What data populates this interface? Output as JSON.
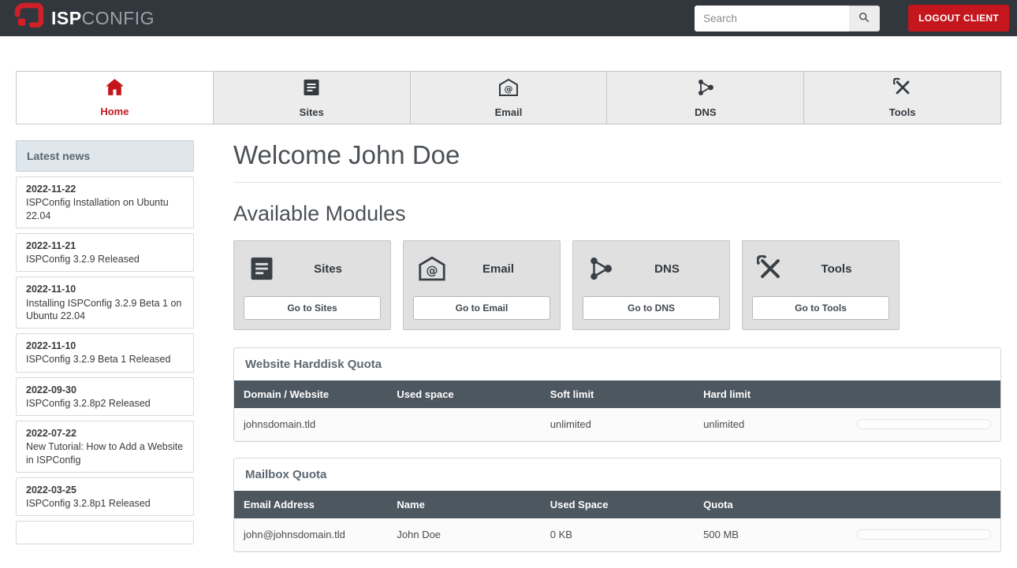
{
  "header": {
    "logo_text_primary": "ISP",
    "logo_text_secondary": "CONFIG",
    "search": {
      "placeholder": "Search",
      "value": ""
    },
    "logout_label": "LOGOUT CLIENT"
  },
  "nav": {
    "tabs": [
      {
        "label": "Home",
        "active": true
      },
      {
        "label": "Sites",
        "active": false
      },
      {
        "label": "Email",
        "active": false
      },
      {
        "label": "DNS",
        "active": false
      },
      {
        "label": "Tools",
        "active": false
      }
    ]
  },
  "sidebar": {
    "title": "Latest news",
    "items": [
      {
        "date": "2022-11-22",
        "title": "ISPConfig Installation on Ubuntu 22.04"
      },
      {
        "date": "2022-11-21",
        "title": "ISPConfig 3.2.9 Released"
      },
      {
        "date": "2022-11-10",
        "title": "Installing ISPConfig 3.2.9 Beta 1 on Ubuntu 22.04"
      },
      {
        "date": "2022-11-10",
        "title": "ISPConfig 3.2.9 Beta 1 Released"
      },
      {
        "date": "2022-09-30",
        "title": "ISPConfig 3.2.8p2 Released"
      },
      {
        "date": "2022-07-22",
        "title": "New Tutorial: How to Add a Website in ISPConfig"
      },
      {
        "date": "2022-03-25",
        "title": "ISPConfig 3.2.8p1 Released"
      }
    ]
  },
  "main": {
    "welcome_title": "Welcome John Doe",
    "modules_title": "Available Modules",
    "modules": [
      {
        "title": "Sites",
        "button": "Go to Sites"
      },
      {
        "title": "Email",
        "button": "Go to Email"
      },
      {
        "title": "DNS",
        "button": "Go to DNS"
      },
      {
        "title": "Tools",
        "button": "Go to Tools"
      }
    ],
    "website_quota": {
      "title": "Website Harddisk Quota",
      "columns": [
        "Domain / Website",
        "Used space",
        "Soft limit",
        "Hard limit"
      ],
      "rows": [
        {
          "domain": "johnsdomain.tld",
          "used": "",
          "soft": "unlimited",
          "hard": "unlimited"
        }
      ]
    },
    "mailbox_quota": {
      "title": "Mailbox Quota",
      "columns": [
        "Email Address",
        "Name",
        "Used Space",
        "Quota"
      ],
      "rows": [
        {
          "email": "john@johnsdomain.tld",
          "name": "John Doe",
          "used": "0 KB",
          "quota": "500 MB"
        }
      ]
    }
  },
  "colors": {
    "accent_red": "#c4161c",
    "topbar_bg": "#31373d",
    "table_header_bg": "#4d5760"
  }
}
